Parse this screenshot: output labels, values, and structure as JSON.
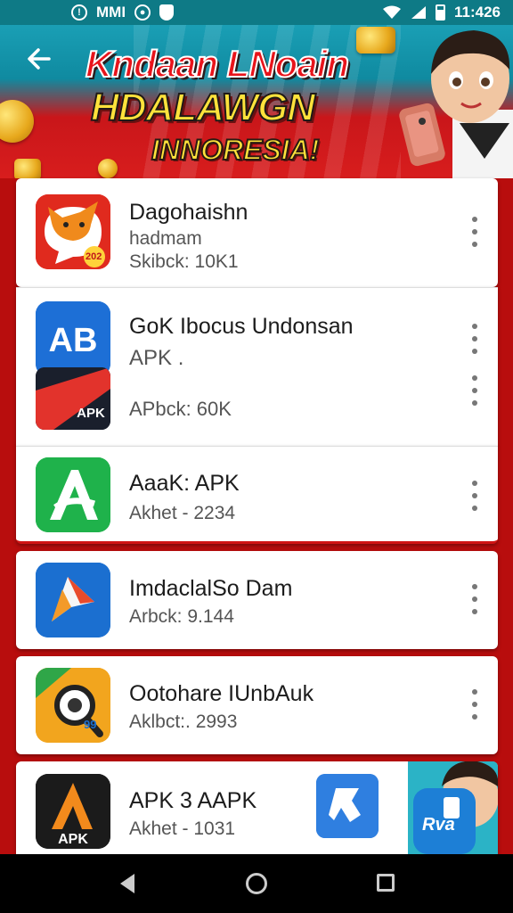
{
  "status_bar": {
    "left_text": "MMI",
    "time": "11:426",
    "icons": [
      "alert-circle-icon",
      "camera-icon",
      "shield-icon",
      "wifi-icon",
      "signal-icon",
      "battery-icon"
    ]
  },
  "header": {
    "title_line1": "Kndaan LNoain",
    "title_line2": "HDALAWGN",
    "title_line3": "INNORESIA!",
    "back_icon": "arrow-left-icon"
  },
  "apps": [
    {
      "name": "Dagohaishn",
      "subtitle": "hadmam",
      "meta": "Skibck: 10K1",
      "icon": "fox-chat-icon",
      "icon_badge": "202"
    },
    {
      "name": "GoK Ibocus Undonsan",
      "subtitle": "APK .",
      "meta": "",
      "icon": "ab-letters-icon"
    },
    {
      "name": "",
      "subtitle": "",
      "meta": "APbck: 60K",
      "icon": "apk-red-stripe-icon",
      "icon_label": "APK"
    },
    {
      "name": "AaaK: APK",
      "subtitle": "",
      "meta": "Akhet - 2234",
      "icon": "green-a-icon"
    },
    {
      "name": "ImdaclalSo Dam",
      "subtitle": "",
      "meta": "Arbck: 9.144",
      "icon": "play-arrow-icon"
    },
    {
      "name": "Ootohare IUnbAuk",
      "subtitle": "",
      "meta": "Aklbct:. 2993",
      "icon": "magnifier-orange-icon",
      "icon_badge": "99"
    },
    {
      "name": "APK 3 AAPK",
      "subtitle": "",
      "meta": "Akhet - 1031",
      "icon": "apk-orange-a-icon",
      "icon_label": "APK"
    }
  ],
  "floating": {
    "blue_icon": "scissors-doc-icon",
    "mascot_badge": "Rva"
  },
  "nav_bar": {
    "buttons": [
      "back-triangle-icon",
      "home-circle-icon",
      "recent-square-icon"
    ]
  },
  "colors": {
    "banner_top": "#1a9fb5",
    "banner_red": "#d81d1d",
    "background_red": "#b80d0d",
    "accent_yellow": "#ffe23b"
  }
}
